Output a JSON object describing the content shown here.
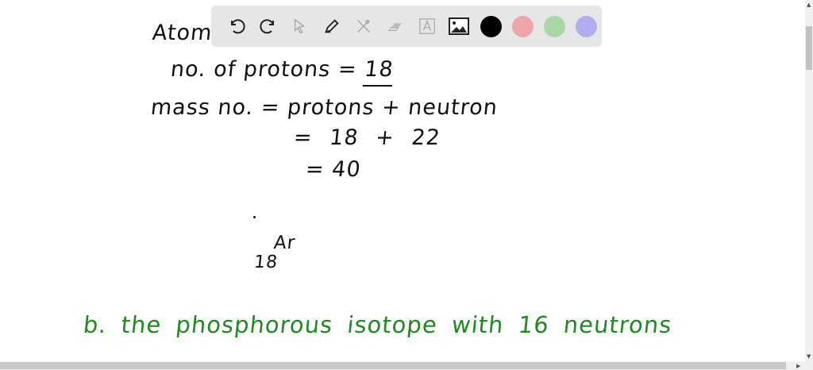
{
  "notes": {
    "heading": "Atom",
    "line1": "no. of protons = ",
    "line1_value": "18",
    "line2": "mass no. = protons + neutron",
    "line3": "= 18 + 22",
    "line4": "= 40",
    "symbol_subscript": "18",
    "symbol": "Ar",
    "part_b": "b.  the phosphorous isotope with 16 neutrons"
  },
  "toolbar": {
    "tools": [
      "undo-icon",
      "redo-icon",
      "select-icon",
      "pen-icon",
      "tools-icon",
      "eraser-icon",
      "text-icon",
      "image-icon"
    ],
    "colors": [
      "#000000",
      "#eba5ab",
      "#a9d8a7",
      "#b0aeee"
    ]
  },
  "colors": {
    "ink": "#111111",
    "green_ink": "#1f8a1f",
    "toolbar_bg": "#e6e6e6"
  }
}
